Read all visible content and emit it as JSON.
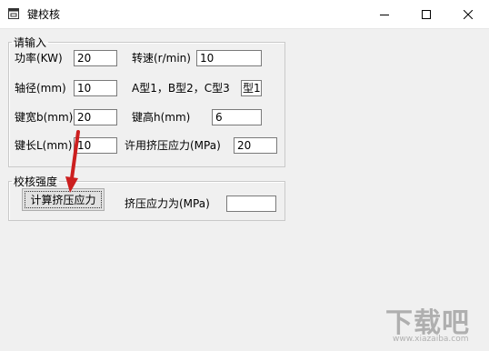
{
  "window": {
    "title": "键校核"
  },
  "input_group": {
    "legend": "请输入",
    "power_label": "功率(KW)",
    "power_value": "20",
    "speed_label": "转速(r/min)",
    "speed_value": "10",
    "shaft_label": "轴径(mm)",
    "shaft_value": "10",
    "type_hint": "A型1，B型2，C型3",
    "type_value": "型1",
    "key_width_label": "键宽b(mm)",
    "key_width_value": "20",
    "key_height_label": "键高h(mm)",
    "key_height_value": "6",
    "key_length_label": "键长L(mm)",
    "key_length_value": "10",
    "allow_stress_label": "许用挤压应力(MPa)",
    "allow_stress_value": "20"
  },
  "check_group": {
    "legend": "校核强度",
    "calc_button": "计算挤压应力",
    "result_label": "挤压应力为(MPa)",
    "result_value": ""
  },
  "watermark": {
    "main": "下载吧",
    "sub": "www.xiazaiba.com"
  },
  "colors": {
    "arrow": "#cc1f1f",
    "titlebar": "#ffffff",
    "window_bg": "#f0f0f0"
  },
  "icons": {
    "app": "vb-form-icon",
    "minimize": "minimize-icon",
    "maximize": "maximize-icon",
    "close": "close-icon"
  }
}
